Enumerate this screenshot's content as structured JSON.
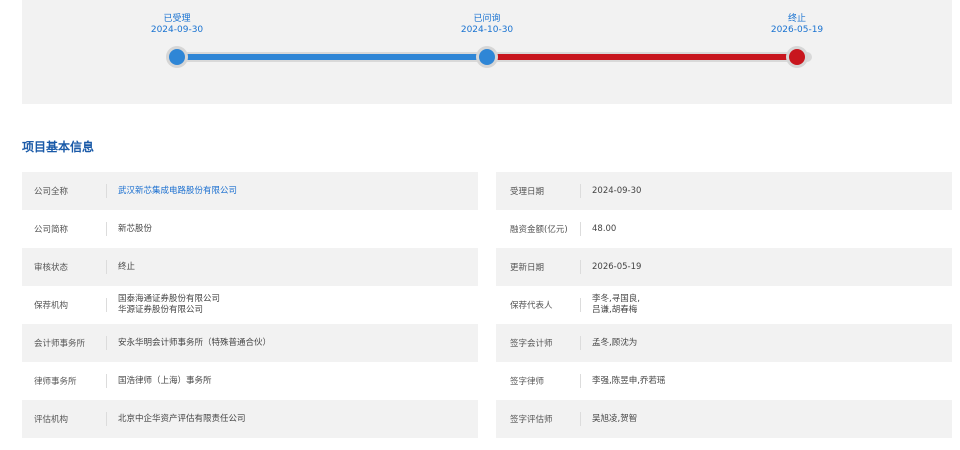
{
  "timeline": {
    "steps": [
      {
        "label": "已受理",
        "date": "2024-09-30",
        "color": "#2f86d6"
      },
      {
        "label": "已问询",
        "date": "2024-10-30",
        "color": "#2f86d6"
      },
      {
        "label": "终止",
        "date": "2026-05-19",
        "color": "#c8161e"
      }
    ]
  },
  "section": {
    "title": "项目基本信息"
  },
  "rows": [
    {
      "left": {
        "label": "公司全称",
        "value": [
          "武汉新芯集成电路股份有限公司"
        ],
        "link": true
      },
      "right": {
        "label": "受理日期",
        "value": [
          "2024-09-30"
        ]
      }
    },
    {
      "left": {
        "label": "公司简称",
        "value": [
          "新芯股份"
        ]
      },
      "right": {
        "label": "融资金额(亿元)",
        "value": [
          "48.00"
        ]
      }
    },
    {
      "left": {
        "label": "审核状态",
        "value": [
          "终止"
        ]
      },
      "right": {
        "label": "更新日期",
        "value": [
          "2026-05-19"
        ]
      }
    },
    {
      "left": {
        "label": "保荐机构",
        "value": [
          "国泰海通证券股份有限公司",
          "华源证券股份有限公司"
        ]
      },
      "right": {
        "label": "保荐代表人",
        "value": [
          "李冬,寻国良,",
          "吕谦,胡春梅"
        ]
      }
    },
    {
      "left": {
        "label": "会计师事务所",
        "value": [
          "安永华明会计师事务所（特殊普通合伙）"
        ]
      },
      "right": {
        "label": "签字会计师",
        "value": [
          "孟冬,顾沈为"
        ]
      }
    },
    {
      "left": {
        "label": "律师事务所",
        "value": [
          "国浩律师（上海）事务所"
        ]
      },
      "right": {
        "label": "签字律师",
        "value": [
          "李强,陈昱申,乔若瑶"
        ]
      }
    },
    {
      "left": {
        "label": "评估机构",
        "value": [
          "北京中企华资产评估有限责任公司"
        ]
      },
      "right": {
        "label": "签字评估师",
        "value": [
          "吴旭凌,贺智"
        ]
      }
    }
  ]
}
